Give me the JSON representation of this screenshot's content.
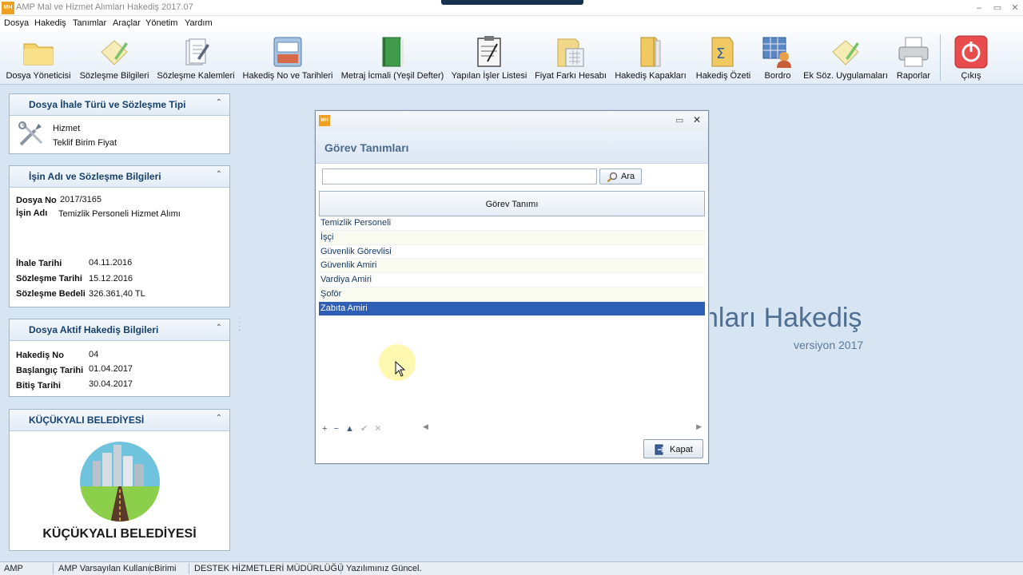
{
  "window": {
    "app_icon_text": "MH",
    "title": "AMP Mal ve Hizmet Alımları Hakediş  2017.07",
    "controls": [
      "–",
      "▭",
      "✕"
    ]
  },
  "menu": [
    "Dosya",
    "Hakediş",
    "Tanımlar",
    "Araçlar",
    "Yönetim",
    "Yardım"
  ],
  "toolbar": {
    "items": [
      {
        "label": "Dosya Yöneticisi",
        "icon": "folder-icon"
      },
      {
        "label": "Sözleşme Bilgileri",
        "icon": "document-pen-icon"
      },
      {
        "label": "Sözleşme Kalemleri",
        "icon": "documents-pen-icon"
      },
      {
        "label": "Hakediş No ve Tarihleri",
        "icon": "tray-icon"
      },
      {
        "label": "Metraj İcmali (Yeşil Defter)",
        "icon": "green-book-icon"
      },
      {
        "label": "Yapılan İşler Listesi",
        "icon": "checklist-icon"
      },
      {
        "label": "Fiyat Farkı Hesabı",
        "icon": "calculator-folder-icon"
      },
      {
        "label": "Hakediş Kapakları",
        "icon": "binder-icon"
      },
      {
        "label": "Hakediş Özeti",
        "icon": "sigma-folder-icon"
      },
      {
        "label": "Bordro",
        "icon": "people-table-icon"
      },
      {
        "label": "Ek Söz. Uygulamaları",
        "icon": "document-pen-icon"
      },
      {
        "label": "Raporlar",
        "icon": "printer-icon"
      },
      {
        "label": "Çıkış",
        "icon": "power-icon"
      }
    ]
  },
  "panels": {
    "contract_type": {
      "title": "Dosya İhale Türü ve Sözleşme Tipi",
      "line1": "Hizmet",
      "line2": "Teklif Birim Fiyat"
    },
    "job_info": {
      "title": "İşin Adı ve Sözleşme Bilgileri",
      "file_no_label": "Dosya No",
      "file_no": "2017/3165",
      "job_name_label": "İşin Adı",
      "job_name": "Temizlik Personeli Hizmet Alımı",
      "tender_date_label": "İhale Tarihi",
      "tender_date": "04.11.2016",
      "contract_date_label": "Sözleşme Tarihi",
      "contract_date": "15.12.2016",
      "contract_amount_label": "Sözleşme Bedeli",
      "contract_amount": "326.361,40 TL"
    },
    "active_payment": {
      "title": "Dosya Aktif Hakediş Bilgileri",
      "payment_no_label": "Hakediş No",
      "payment_no": "04",
      "start_date_label": "Başlangıç Tarihi",
      "start_date": "01.04.2017",
      "end_date_label": "Bitiş Tarihi",
      "end_date": "30.04.2017"
    },
    "municipality": {
      "title": "KÜÇÜKYALI BELEDİYESİ",
      "logo_text": "KÜÇÜKYALI BELEDİYESİ"
    }
  },
  "background": {
    "title_fragment": "nları Hakediş",
    "version": "versiyon 2017"
  },
  "dialog": {
    "icon_text": "MH",
    "heading": "Görev Tanımları",
    "search_value": "",
    "search_button": "Ara",
    "column_header": "Görev Tanımı",
    "rows": [
      "Temizlik Personeli",
      "İşçi",
      "Güvenlik Görevlisi",
      "Güvenlik Amiri",
      "Vardiya Amiri",
      "Şoför",
      "Zabıta Amiri"
    ],
    "selected_row": "Zabıta Amiri",
    "nav_buttons": [
      "+",
      "−",
      "▲",
      "✔",
      "✕"
    ],
    "close_button": "Kapat"
  },
  "statusbar": [
    "AMP",
    "AMP Varsayılan Kullanıcı",
    "Birimi",
    "DESTEK HİZMETLERİ MÜDÜRLÜĞÜ",
    "Yazılımınız Güncel."
  ],
  "colors": {
    "selection": "#2f5fb5",
    "panel_title": "#15406e",
    "background": "#d7e4f2"
  }
}
